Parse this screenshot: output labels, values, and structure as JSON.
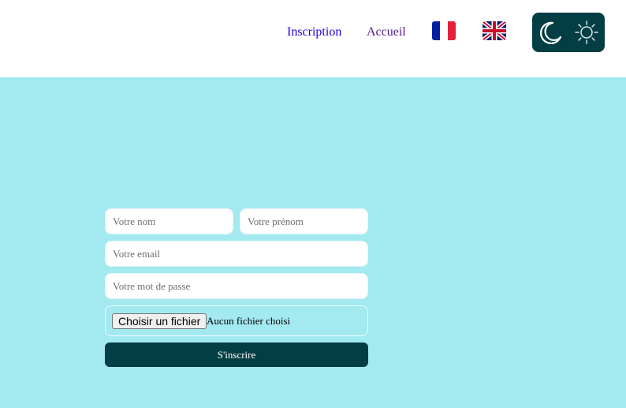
{
  "header": {
    "nav": {
      "inscription": "Inscription",
      "accueil": "Accueil"
    },
    "languages": [
      {
        "code": "fr",
        "icon": "france-flag-icon"
      },
      {
        "code": "en",
        "icon": "uk-flag-icon"
      }
    ],
    "theme_toggle": {
      "icons": [
        "moon-icon",
        "sun-icon"
      ],
      "color": "#033e44"
    }
  },
  "form": {
    "nom_placeholder": "Votre nom",
    "prenom_placeholder": "Votre prénom",
    "email_placeholder": "Votre email",
    "password_placeholder": "Votre mot de passe",
    "file_button_label": "Choisir un fichier",
    "file_status": "Aucun fichier choisi",
    "submit_label": "S'inscrire"
  },
  "colors": {
    "background": "#a3e9f0",
    "accent": "#033e44",
    "link": "#2200dd",
    "visited_link": "#551a8b"
  }
}
